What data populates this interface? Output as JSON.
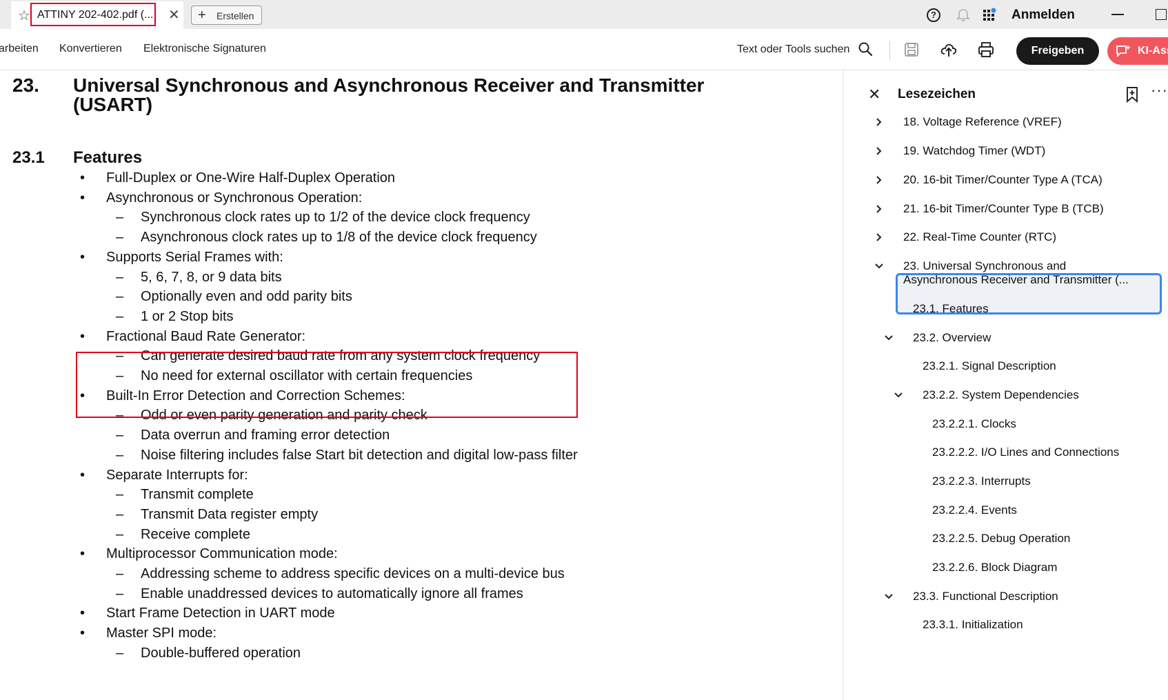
{
  "tab": {
    "title": "ATTINY 202-402.pdf (...",
    "new_label": "Erstellen"
  },
  "account": {
    "signin": "Anmelden"
  },
  "menu": {
    "items": [
      "arbeiten",
      "Konvertieren",
      "Elektronische Signaturen"
    ],
    "search_label": "Text oder Tools suchen",
    "share": "Freigeben",
    "ai": "KI-Assistent"
  },
  "doc": {
    "section_num": "23.",
    "section_title_1": "Universal Synchronous and Asynchronous Receiver and Transmitter",
    "section_title_2": "(USART)",
    "sub_num": "23.1",
    "sub_title": "Features",
    "lines": [
      {
        "level": 1,
        "text": "Full-Duplex or One-Wire Half-Duplex Operation"
      },
      {
        "level": 1,
        "text": "Asynchronous or Synchronous Operation:"
      },
      {
        "level": 2,
        "text": "Synchronous clock rates up to 1/2 of the device clock frequency"
      },
      {
        "level": 2,
        "text": "Asynchronous clock rates up to 1/8 of the device clock frequency"
      },
      {
        "level": 1,
        "text": "Supports Serial Frames with:"
      },
      {
        "level": 2,
        "text": "5, 6, 7, 8, or 9 data bits"
      },
      {
        "level": 2,
        "text": "Optionally even and odd parity bits"
      },
      {
        "level": 2,
        "text": "1 or 2 Stop bits"
      },
      {
        "level": 1,
        "text": "Fractional Baud Rate Generator:"
      },
      {
        "level": 2,
        "text": "Can generate desired baud rate from any system clock frequency"
      },
      {
        "level": 2,
        "text": "No need for external oscillator with certain frequencies"
      },
      {
        "level": 1,
        "text": "Built-In Error Detection and Correction Schemes:"
      },
      {
        "level": 2,
        "text": "Odd or even parity generation and parity check"
      },
      {
        "level": 2,
        "text": "Data overrun and framing error detection"
      },
      {
        "level": 2,
        "text": "Noise filtering includes false Start bit detection and digital low-pass filter"
      },
      {
        "level": 1,
        "text": "Separate Interrupts for:"
      },
      {
        "level": 2,
        "text": "Transmit complete"
      },
      {
        "level": 2,
        "text": "Transmit Data register empty"
      },
      {
        "level": 2,
        "text": "Receive complete"
      },
      {
        "level": 1,
        "text": "Multiprocessor Communication mode:"
      },
      {
        "level": 2,
        "text": "Addressing scheme to address specific devices on a multi-device bus"
      },
      {
        "level": 2,
        "text": "Enable unaddressed devices to automatically ignore all frames"
      },
      {
        "level": 1,
        "text": "Start Frame Detection in UART mode"
      },
      {
        "level": 1,
        "text": "Master SPI mode:"
      },
      {
        "level": 2,
        "text": "Double-buffered operation"
      }
    ]
  },
  "bookmarks": {
    "title": "Lesezeichen",
    "items": [
      {
        "label": "18. Voltage Reference (VREF)",
        "depth": 0,
        "chevron": "right"
      },
      {
        "label": "19. Watchdog Timer (WDT)",
        "depth": 0,
        "chevron": "right"
      },
      {
        "label": "20. 16-bit Timer/Counter Type A (TCA)",
        "depth": 0,
        "chevron": "right"
      },
      {
        "label": "21. 16-bit Timer/Counter Type B (TCB)",
        "depth": 0,
        "chevron": "right"
      },
      {
        "label": "22. Real-Time Counter (RTC)",
        "depth": 0,
        "chevron": "right"
      },
      {
        "label": "23. Universal Synchronous and",
        "label2": "Asynchronous Receiver and Transmitter (...",
        "depth": 0,
        "chevron": "down",
        "selected": true
      },
      {
        "label": "23.1. Features",
        "depth": 1,
        "chevron": "none"
      },
      {
        "label": "23.2. Overview",
        "depth": 1,
        "chevron": "down"
      },
      {
        "label": "23.2.1. Signal Description",
        "depth": 2,
        "chevron": "none"
      },
      {
        "label": "23.2.2. System Dependencies",
        "depth": 2,
        "chevron": "down"
      },
      {
        "label": "23.2.2.1. Clocks",
        "depth": 3,
        "chevron": "none"
      },
      {
        "label": "23.2.2.2. I/O Lines and Connections",
        "depth": 3,
        "chevron": "none"
      },
      {
        "label": "23.2.2.3. Interrupts",
        "depth": 3,
        "chevron": "none"
      },
      {
        "label": "23.2.2.4. Events",
        "depth": 3,
        "chevron": "none"
      },
      {
        "label": "23.2.2.5. Debug Operation",
        "depth": 3,
        "chevron": "none"
      },
      {
        "label": "23.2.2.6. Block Diagram",
        "depth": 3,
        "chevron": "none"
      },
      {
        "label": "23.3. Functional Description",
        "depth": 1,
        "chevron": "down"
      },
      {
        "label": "23.3.1. Initialization",
        "depth": 2,
        "chevron": "none"
      }
    ]
  },
  "colors": {
    "highlight_red": "#e0001b",
    "selection_blue": "#3a86f0",
    "ai_button": "#f0565c",
    "notification_dot": "#3a86f0"
  }
}
